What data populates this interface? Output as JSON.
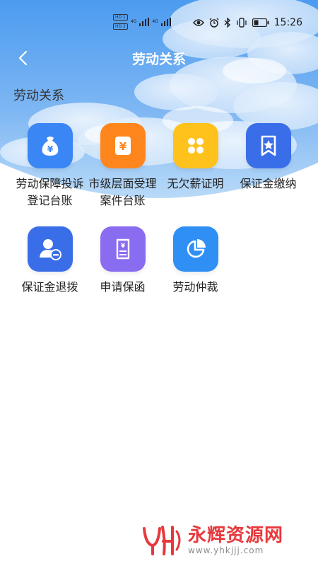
{
  "status_bar": {
    "sim1_badge": "HD 1",
    "sim2_badge": "HD 2",
    "sim1_net": "4G",
    "sim2_net": "4G",
    "time": "15:26"
  },
  "nav": {
    "title": "劳动关系"
  },
  "section": {
    "title": "劳动关系"
  },
  "items": [
    {
      "label": "劳动保障投诉登记台账",
      "icon": "money-bag-icon",
      "color": "#3b82f6"
    },
    {
      "label": "市级层面受理案件台账",
      "icon": "yuan-doc-icon",
      "color": "#ff8a1f"
    },
    {
      "label": "无欠薪证明",
      "icon": "clover-icon",
      "color": "#ffc21f"
    },
    {
      "label": "保证金缴纳",
      "icon": "bookmark-star-icon",
      "color": "#3a6ee8"
    },
    {
      "label": "保证金退拨",
      "icon": "user-minus-icon",
      "color": "#3a6ee8"
    },
    {
      "label": "申请保函",
      "icon": "yuan-tag-icon",
      "color": "#8a6cf0"
    },
    {
      "label": "劳动仲裁",
      "icon": "pie-chart-icon",
      "color": "#2f8ff5"
    }
  ],
  "watermark": {
    "brand": "永辉资源网",
    "url": "www.yhkjjj.com"
  },
  "colors": {
    "sky_top": "#4f9ef0",
    "sky_bottom": "#9cc9f6",
    "accent_red": "#e8383c"
  }
}
